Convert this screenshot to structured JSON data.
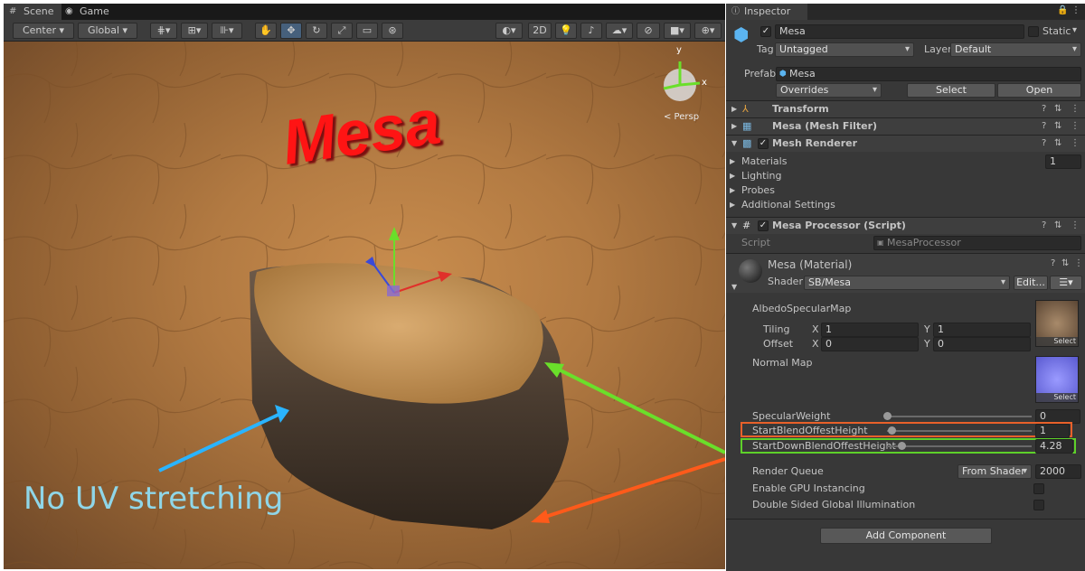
{
  "scene_panel": {
    "tabs": [
      {
        "label": "Scene",
        "icon": "grid-icon"
      },
      {
        "label": "Game",
        "icon": "gamepad-icon"
      }
    ],
    "toolbar": {
      "pivot": "Center",
      "space": "Global",
      "btn_2d": "2D"
    },
    "overlay": {
      "title": "Mesa",
      "caption": "No UV stretching",
      "persp": "< Persp",
      "gizmo_y": "y",
      "gizmo_x": "x"
    },
    "colors": {
      "title": "#ff1414",
      "caption": "#8fd6e8",
      "arrow_blue": "#2ab4ff",
      "arrow_green": "#6adf2a",
      "arrow_orange": "#ff5a1a"
    }
  },
  "inspector": {
    "tab": "Inspector",
    "object": {
      "name": "Mesa",
      "static_label": "Static",
      "tag_label": "Tag",
      "tag": "Untagged",
      "layer_label": "Layer",
      "layer": "Default"
    },
    "prefab": {
      "label": "Prefab",
      "value": "Mesa",
      "overrides": "Overrides",
      "select": "Select",
      "open": "Open"
    },
    "components": [
      {
        "name": "Transform"
      },
      {
        "name": "Mesa (Mesh Filter)"
      },
      {
        "name": "Mesh Renderer"
      }
    ],
    "renderer": {
      "materials": "Materials",
      "materials_count": "1",
      "lighting": "Lighting",
      "probes": "Probes",
      "additional": "Additional Settings"
    },
    "script_comp": {
      "name": "Mesa Processor (Script)",
      "script_label": "Script",
      "script_value": "MesaProcessor"
    },
    "material": {
      "name": "Mesa (Material)",
      "shader_label": "Shader",
      "shader": "SB/Mesa",
      "edit": "Edit...",
      "albedo": "AlbedoSpecularMap",
      "tiling": "Tiling",
      "offset": "Offset",
      "tex_select": "Select",
      "tiling_x": "1",
      "tiling_y": "1",
      "offset_x": "0",
      "offset_y": "0",
      "x": "X",
      "y": "Y",
      "normal": "Normal Map",
      "props": [
        {
          "label": "SpecularWeight",
          "value": "0",
          "fraction": 0.0
        },
        {
          "label": "StartBlendOffestHeight",
          "value": "1",
          "fraction": 0.03
        },
        {
          "label": "StartDownBlendOffestHeight",
          "value": "4.28",
          "fraction": 0.1
        }
      ],
      "render_queue_label": "Render Queue",
      "render_queue_mode": "From Shader",
      "render_queue_value": "2000",
      "gpu_instancing": "Enable GPU Instancing",
      "double_sided": "Double Sided Global Illumination"
    },
    "add_component": "Add Component",
    "highlight_colors": {
      "orange": "#e8602a",
      "green": "#5ed02a"
    }
  }
}
